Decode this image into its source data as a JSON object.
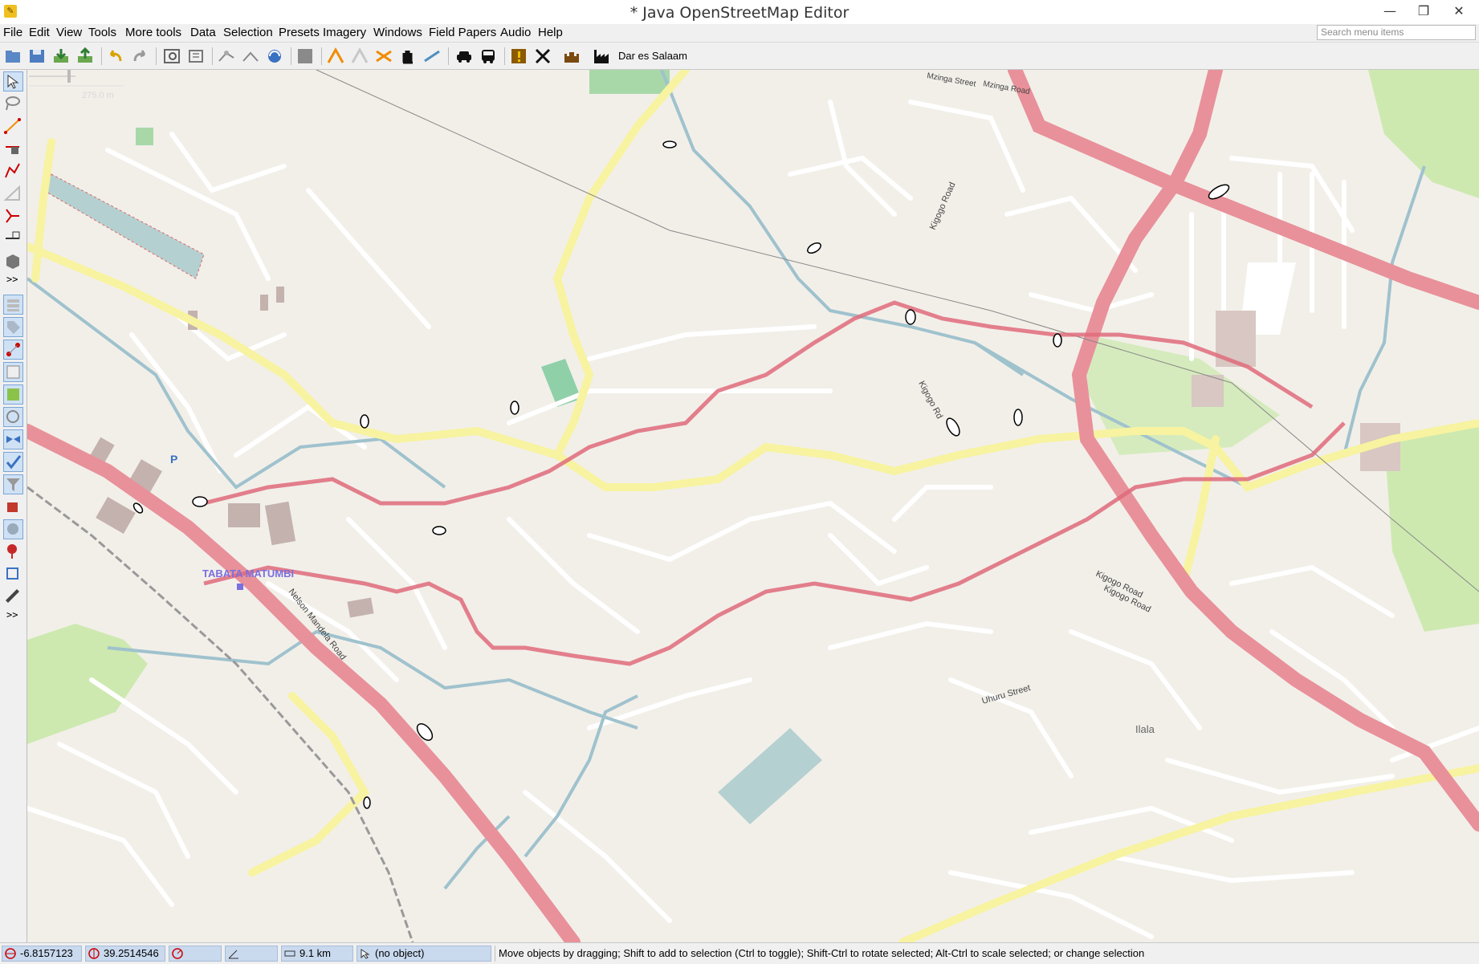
{
  "window": {
    "title": "* Java OpenStreetMap Editor"
  },
  "menu": {
    "items": [
      "File",
      "Edit",
      "View",
      "Tools",
      "More tools",
      "Data",
      "Selection",
      "Presets",
      "Imagery",
      "Windows",
      "Field Papers",
      "Audio",
      "Help"
    ],
    "search_placeholder": "Search menu items"
  },
  "toolbar": {
    "buttons": [
      "open-file",
      "save",
      "upload",
      "download",
      "undo",
      "redo",
      "preferences",
      "zoom",
      "split-way",
      "combine",
      "align",
      "layer",
      "anchor",
      "hand",
      "ruler",
      "car",
      "bus",
      "warning",
      "cross",
      "castle",
      "factory"
    ],
    "location_label": "Dar es Salaam"
  },
  "left_toolbar": {
    "tools": [
      "select",
      "lasso",
      "draw",
      "improve-way",
      "extrude",
      "parallel",
      "join-nodes",
      "splitting",
      "building",
      "more-1",
      "layers",
      "tags",
      "relations",
      "history",
      "preferences-img",
      "notes",
      "conflict",
      "validation",
      "filter",
      "paint",
      "bug",
      "overpass",
      "measure",
      "more-2"
    ],
    "more_label": ">>"
  },
  "map": {
    "scale_label": "275.0 m",
    "places": {
      "tabata": "TABATA MATUMBI",
      "ilala": "Ilala",
      "parking": "P"
    },
    "roads": {
      "nelson_1": "Nelson Mandela Road",
      "nelson_2": "Nelson Mandela Road",
      "kigogo_rd_short": "Kigogo Rd",
      "kigogo_road_1": "Kigogo Road",
      "kigogo_road_2": "Kigogo Road",
      "uhuru": "Uhuru Street",
      "kigogo_vertical": "Kigogo Road",
      "msimbazi_1": "Mzinga Street",
      "msimbazi_2": "Mzinga Road"
    }
  },
  "status": {
    "latitude": "-6.8157123",
    "longitude": "39.2514546",
    "heading": "",
    "angle": "",
    "distance": "9.1 km",
    "object": "(no object)",
    "help": "Move objects by dragging; Shift to add to selection (Ctrl to toggle); Shift-Ctrl to rotate selected; Alt-Ctrl to scale selected; or change selection"
  },
  "colors": {
    "primary_road": "#e8919a",
    "secondary_road": "#f7f3a0",
    "river": "#9fc2cd",
    "gps_track": "#e06b7b",
    "park": "#cde9b0",
    "building": "#c4b2ae"
  }
}
